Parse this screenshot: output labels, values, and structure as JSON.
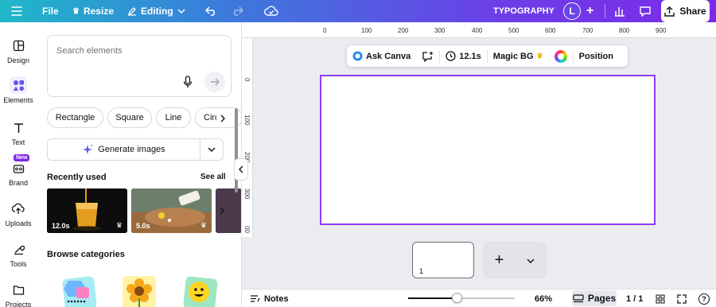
{
  "topbar": {
    "file_label": "File",
    "resize_label": "Resize",
    "editing_label": "Editing",
    "project_title": "TYPOGRAPHY",
    "avatar_initial": "L",
    "share_label": "Share"
  },
  "rail": {
    "items": [
      {
        "label": "Design",
        "icon": "design-icon"
      },
      {
        "label": "Elements",
        "icon": "elements-icon"
      },
      {
        "label": "Text",
        "icon": "text-icon"
      },
      {
        "label": "Brand",
        "icon": "brand-icon",
        "badge": "New"
      },
      {
        "label": "Uploads",
        "icon": "uploads-icon"
      },
      {
        "label": "Tools",
        "icon": "tools-icon"
      },
      {
        "label": "Projects",
        "icon": "projects-icon"
      }
    ]
  },
  "panel": {
    "search_placeholder": "Search elements",
    "chips": [
      "Rectangle",
      "Square",
      "Line",
      "Circ"
    ],
    "generate_label": "Generate images",
    "recently_used_title": "Recently used",
    "see_all_label": "See all",
    "recent_items": [
      {
        "duration": "12.0s"
      },
      {
        "duration": "5.0s"
      }
    ],
    "browse_title": "Browse categories"
  },
  "ruler": {
    "top_ticks": [
      "0",
      "100",
      "200",
      "300",
      "400",
      "500",
      "600",
      "700",
      "800",
      "900"
    ],
    "left_ticks": [
      "0",
      "100",
      "200",
      "300",
      "00"
    ]
  },
  "context_toolbar": {
    "ask_canva": "Ask Canva",
    "duration": "12.1s",
    "magic_bg": "Magic BG",
    "position": "Position"
  },
  "pages_strip": {
    "page_number": "1"
  },
  "bottombar": {
    "notes_label": "Notes",
    "zoom_value": "66%",
    "zoom_fraction": 0.46,
    "pages_label": "Pages",
    "page_counter": "1 / 1"
  },
  "colors": {
    "accent": "#8b3dff",
    "topbar_start": "#1fb8c8",
    "topbar_end": "#7d2ae8"
  }
}
